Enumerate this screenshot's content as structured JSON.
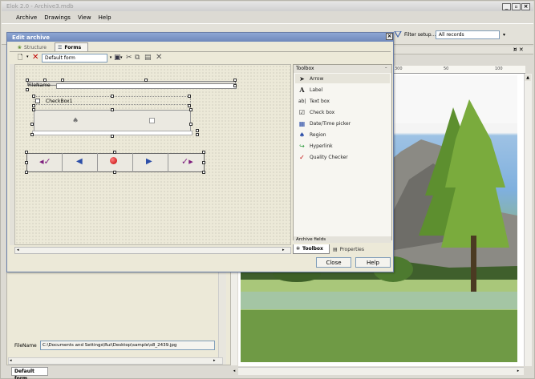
{
  "app": {
    "title": "Elok 2.0 - Archive3.mdb"
  },
  "menu": {
    "archive": "Archive",
    "drawings": "Drawings",
    "view": "View",
    "help": "Help"
  },
  "toolbar": {
    "filter_setup": "Filter setup...",
    "records_value": "All records"
  },
  "dialog": {
    "title": "Edit archive",
    "tab_structure": "Structure",
    "tab_forms": "Forms",
    "form_select": "Default form",
    "close_label": "Close",
    "help_label": "Help"
  },
  "form_design": {
    "filename_label": "FileName",
    "checkbox_label": "CheckBox1"
  },
  "toolbox": {
    "title": "Toolbox",
    "items": [
      "Arrow",
      "Label",
      "Text box",
      "Check box",
      "Date/Time picker",
      "Region",
      "Hyperlink",
      "Quality Checker"
    ],
    "icons": [
      "arrow-icon",
      "label-icon",
      "textbox-icon",
      "checkbox-icon",
      "datetime-icon",
      "region-icon",
      "hyperlink-icon",
      "quality-icon"
    ]
  },
  "panel_tabs": {
    "archive_fields": "Archive fields",
    "toolbox": "Toolbox",
    "properties": "Properties"
  },
  "ruler": {
    "marks": [
      "300",
      "50",
      "100"
    ]
  },
  "bottom": {
    "filename_label": "FileName",
    "filename_value": "C:\\Documents and Settings\\Rui\\Desktop\\sample\\s8_2439.jpg",
    "status_tab": "Default form"
  },
  "colors": {
    "titlebar": "#7d97c9",
    "accent": "#c00000",
    "dialog_bg": "#ece9d8"
  }
}
